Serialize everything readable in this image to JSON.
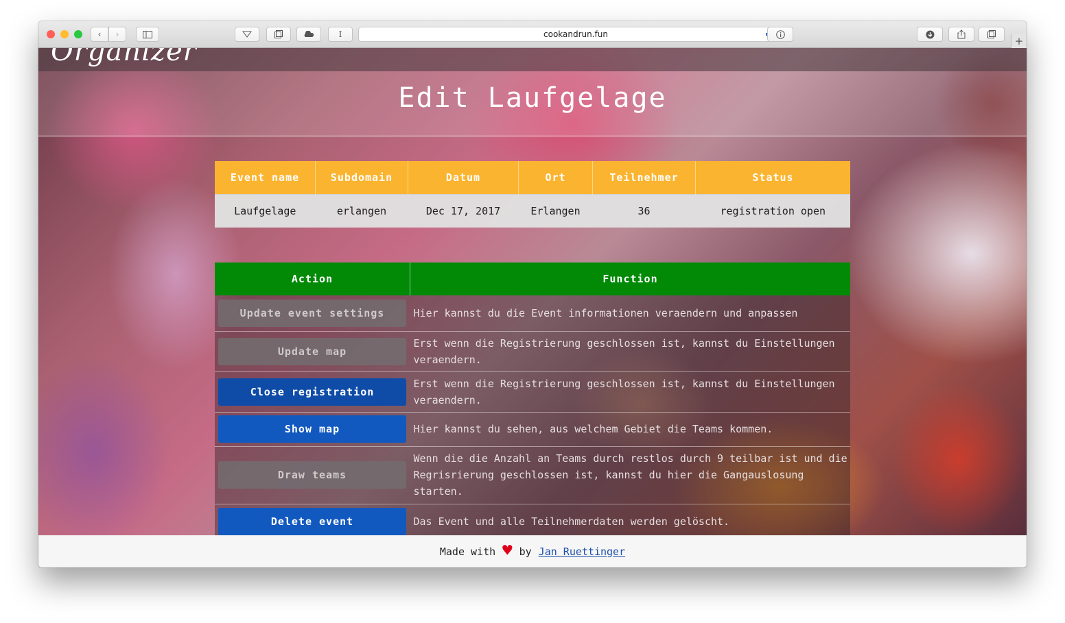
{
  "browser": {
    "url": "cookandrun.fun",
    "new_tab_symbol": "+",
    "reader_symbol": "I",
    "colors": {
      "close": "#ff5f57",
      "minimize": "#febc2e",
      "maximize": "#28c840"
    }
  },
  "site": {
    "logo_text": "Organizer",
    "page_title": "Edit Laufgelage"
  },
  "event_table": {
    "headers": [
      "Event name",
      "Subdomain",
      "Datum",
      "Ort",
      "Teilnehmer",
      "Status"
    ],
    "row": [
      "Laufgelage",
      "erlangen",
      "Dec 17, 2017",
      "Erlangen",
      "36",
      "registration open"
    ]
  },
  "action_table": {
    "headers": [
      "Action",
      "Function"
    ],
    "rows": [
      {
        "action": "Update event settings",
        "function": "Hier kannst du die Event informationen veraendern und anpassen"
      },
      {
        "action": "Update map",
        "function": "Erst wenn die Registrierung geschlossen ist, kannst du Einstellungen veraendern."
      },
      {
        "action": "Close registration",
        "function": "Erst wenn die Registrierung geschlossen ist, kannst du Einstellungen veraendern."
      },
      {
        "action": "Show map",
        "function": "Hier kannst du sehen, aus welchem Gebiet die Teams kommen."
      },
      {
        "action": "Draw teams",
        "function": "Wenn die die Anzahl an Teams durch restlos durch 9 teilbar ist und die Regrisrierung geschlossen ist, kannst du hier die Gangauslosung starten."
      },
      {
        "action": "Delete event",
        "function": "Das Event und alle Teilnehmerdaten werden gelöscht."
      }
    ]
  },
  "footer": {
    "made_with": "Made with",
    "heart": "♥",
    "by": "by",
    "author": "Jan Ruettinger"
  },
  "colors": {
    "event_header": "#fbb430",
    "action_header": "#028a07",
    "button_active": "#1259bf",
    "heart": "#e0001b"
  }
}
